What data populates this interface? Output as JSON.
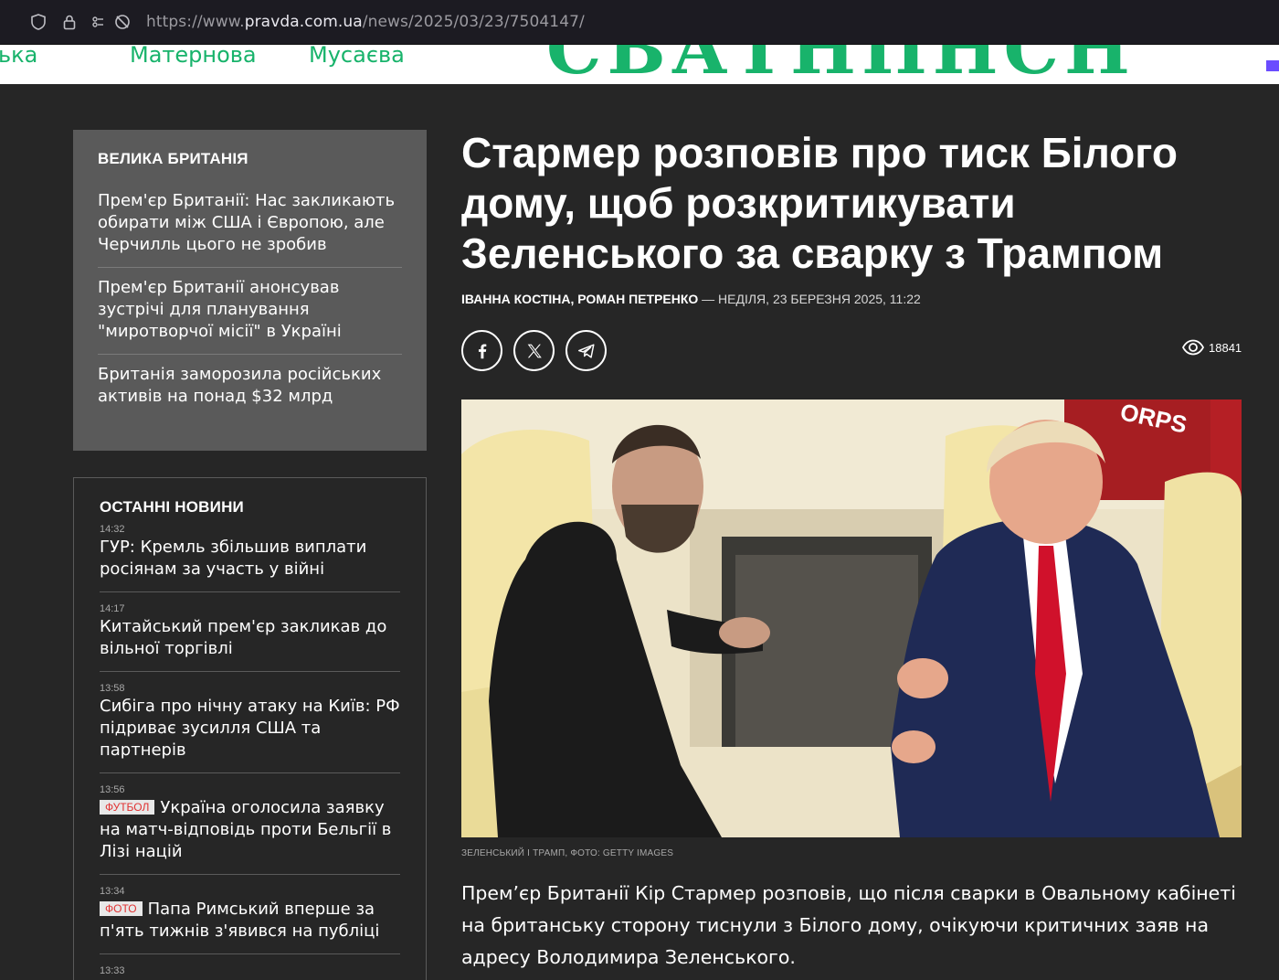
{
  "browser": {
    "url_prefix": "https://www.",
    "url_host": "pravda.com.ua",
    "url_path": "/news/2025/03/23/7504147/"
  },
  "banner": {
    "items": [
      "ька",
      "Матернова",
      "Мусаєва"
    ],
    "logo_text": "СВАТНПНСН"
  },
  "related": {
    "title": "Велика Британія",
    "items": [
      "Прем'єр Британії: Нас закликають обирати між США і Європою, але Черчилль цього не зробив",
      "Прем'єр Британії анонсував зустрічі для планування \"миротворчої місії\" в Україні",
      "Британія заморозила російських активів на понад $32 млрд"
    ]
  },
  "latest": {
    "title": "Останні новини",
    "items": [
      {
        "time": "14:32",
        "tag": "",
        "title": "ГУР: Кремль збільшив виплати росіянам за участь у війні"
      },
      {
        "time": "14:17",
        "tag": "",
        "title": "Китайський прем'єр закликав до вільної торгівлі"
      },
      {
        "time": "13:58",
        "tag": "",
        "title": "Сибіга про нічну атаку на Київ: РФ підриває зусилля США та партнерів"
      },
      {
        "time": "13:56",
        "tag": "Футбол",
        "title": "Україна оголосила заявку на матч-відповідь проти Бельгії в Лізі націй"
      },
      {
        "time": "13:34",
        "tag": "Фото",
        "title": "Папа Римський вперше за п'ять тижнів з'явився на публіці"
      },
      {
        "time": "13:33",
        "tag": "",
        "title": ""
      }
    ]
  },
  "article": {
    "headline": "Стармер розповів про тиск Білого дому, щоб розкритикувати Зеленського за сварку з Трампом",
    "authors": "Іванна Костіна, Роман Петренко",
    "separator": " — ",
    "date": "Неділя, 23 березня 2025, 11:22",
    "views": "18841",
    "share_icons": [
      "facebook-icon",
      "x-icon",
      "telegram-icon"
    ],
    "photo_text": "ORPS",
    "caption": "Зеленський і Трамп, фото: Getty Images",
    "lead": "Прем’єр Британії Кір Стармер розповів, що після сварки в Овальному кабінеті на британську сторону тиснули з Білого дому, очікуючи критичних заяв на адресу Володимира Зеленського."
  },
  "colors": {
    "background": "#262626",
    "sidebar_box": "#5a5a5a",
    "banner_green": "#18b36b",
    "tag_red": "#e03131"
  }
}
